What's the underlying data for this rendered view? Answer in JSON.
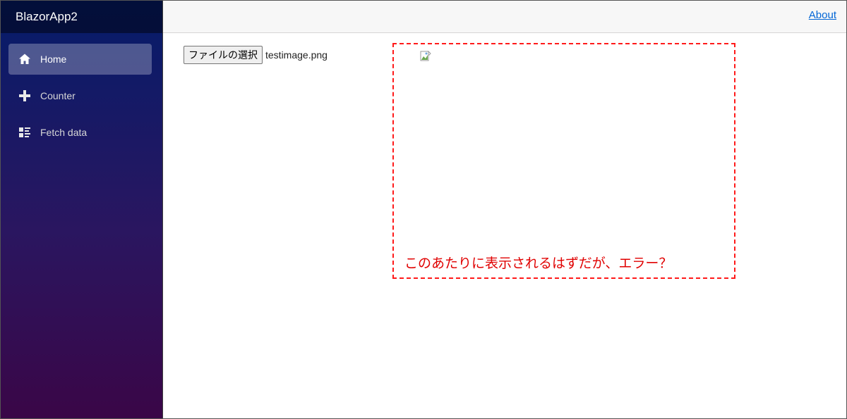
{
  "sidebar": {
    "brand": "BlazorApp2",
    "items": [
      {
        "label": "Home",
        "icon": "home-icon",
        "active": true
      },
      {
        "label": "Counter",
        "icon": "plus-icon",
        "active": false
      },
      {
        "label": "Fetch data",
        "icon": "list-rich-icon",
        "active": false
      }
    ]
  },
  "topbar": {
    "about_label": "About"
  },
  "main": {
    "file_button_label": "ファイルの選択",
    "file_name": "testimage.png",
    "broken_image_icon": "broken-image-icon",
    "annotation_text": "このあたりに表示されるはずだが、エラー？"
  },
  "colors": {
    "sidebar_top": "#051c6a",
    "sidebar_bottom": "#3a0647",
    "link": "#0366d6",
    "annotation": "#ff1a1a"
  }
}
